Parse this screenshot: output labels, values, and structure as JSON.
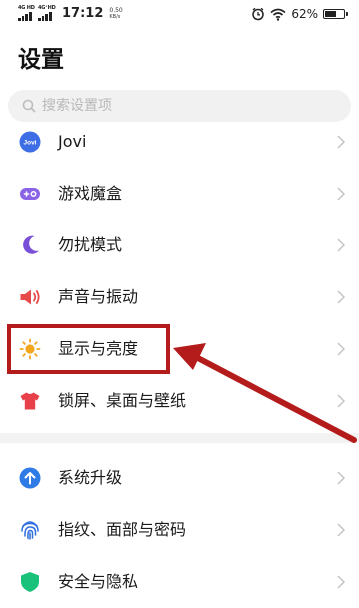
{
  "status_bar": {
    "signal_1": "4G HD",
    "signal_2": "4G⁺HD",
    "time": "17:12",
    "net_speed_value": "0.50",
    "net_speed_unit": "KB/s",
    "battery_percent": "62%",
    "battery_level": 0.62,
    "icons": [
      "signal-icon",
      "signal-icon",
      "alarm-icon",
      "wifi-icon",
      "battery-icon"
    ]
  },
  "header": {
    "title": "设置"
  },
  "search": {
    "placeholder": "搜索设置项"
  },
  "settings": {
    "items": [
      {
        "label": "Jovi",
        "icon": "jovi-icon",
        "icon_text": "Jovi",
        "color": "#3d6ee6"
      },
      {
        "label": "游戏魔盒",
        "icon": "gamepad-icon",
        "color": "#8b63e6"
      },
      {
        "label": "勿扰模式",
        "icon": "moon-icon",
        "color": "#7b50d8"
      },
      {
        "label": "声音与振动",
        "icon": "speaker-icon",
        "color": "#e84a4a"
      },
      {
        "label": "显示与亮度",
        "icon": "sun-icon",
        "color": "#f3a51c"
      },
      {
        "label": "锁屏、桌面与壁纸",
        "icon": "shirt-icon",
        "color": "#e8404a"
      },
      {
        "label": "系统升级",
        "icon": "upgrade-icon",
        "color": "#2f7be6"
      },
      {
        "label": "指纹、面部与密码",
        "icon": "fingerprint-icon",
        "color": "#2f6fe0"
      },
      {
        "label": "安全与隐私",
        "icon": "shield-icon",
        "color": "#19c17a"
      }
    ]
  },
  "annotation": {
    "color": "#b41c1c"
  }
}
